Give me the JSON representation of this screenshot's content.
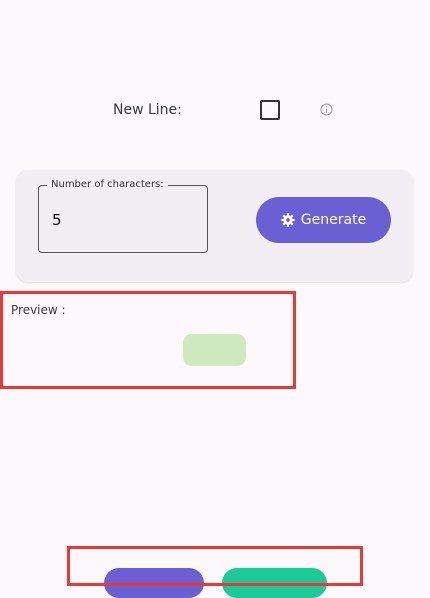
{
  "settings": {
    "new_line_label": "New Line:",
    "new_line_checked": false,
    "info_icon": "info-icon"
  },
  "generator": {
    "field_label": "Number of characters:",
    "field_value": "5",
    "generate_label": "Generate",
    "generate_icon": "gear-icon"
  },
  "preview": {
    "label": "Preview :"
  },
  "colors": {
    "accent": "#6a60d3",
    "secondary": "#1ec998",
    "preview_chip": "#cfe9bf",
    "highlight": "#e83838"
  }
}
